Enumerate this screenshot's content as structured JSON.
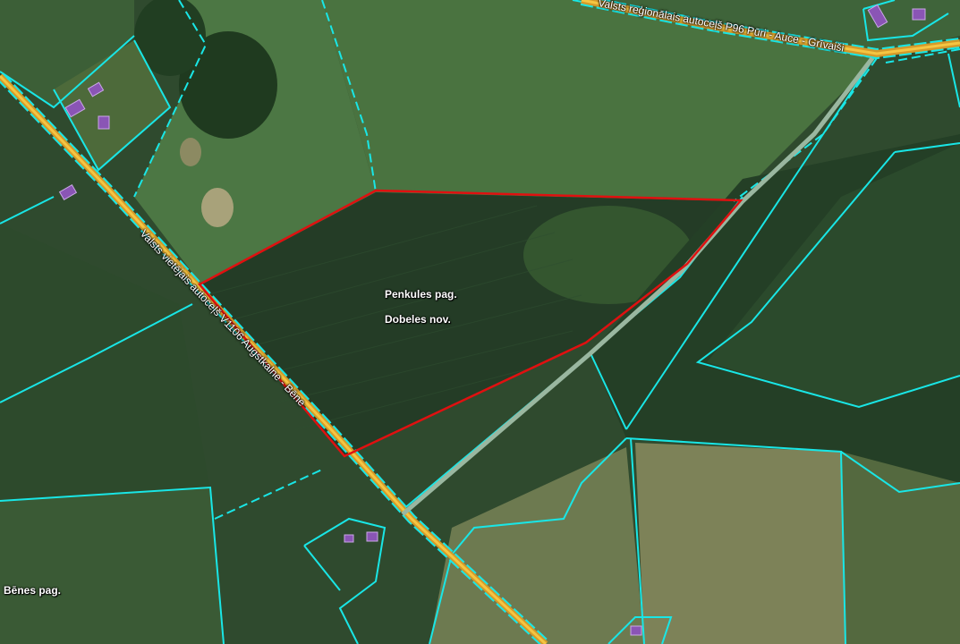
{
  "map": {
    "parish_labels": {
      "penkule": "Penkules pag.",
      "dobele": "Dobeles nov.",
      "bene": "Bēnes pag."
    },
    "road_labels": {
      "regional": "Valsts reģionālais autoceļš P96 Pūri - Auce - Grīvaiši",
      "local": "Valsts vietējais autoceļš V1106 Augstkalne - Bēne"
    },
    "colors": {
      "parcel_boundary": "#19e6e6",
      "selected_parcel": "#e01010",
      "road_casing": "#d49a2a",
      "road_fill": "#f5c542",
      "building": "#8a55b5",
      "field_green": "#40663a",
      "field_dark": "#223b25",
      "field_tan": "#7f8a5c"
    }
  }
}
